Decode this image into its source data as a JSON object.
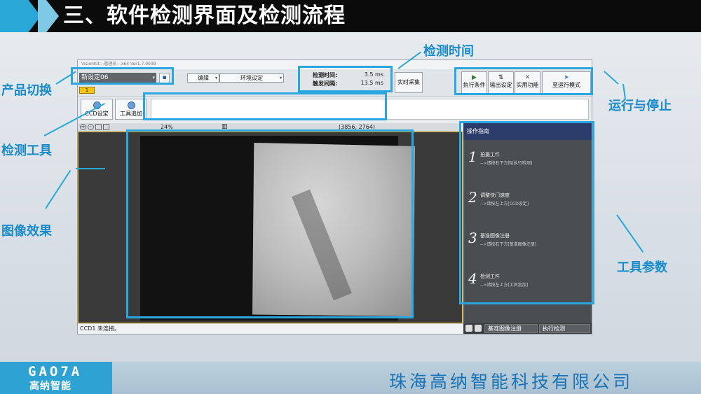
{
  "slide": {
    "title": "三、软件检测界面及检测流程",
    "company": "珠海高纳智能科技有限公司",
    "logo_text": "GAO7A",
    "logo_cn": "高纳智能"
  },
  "annotations": {
    "product_switch": "产品切换",
    "detect_time": "检测时间",
    "run_stop": "运行与停止",
    "detect_tool": "检测工具",
    "image_effect": "图像效果",
    "tool_params": "工具参数"
  },
  "app": {
    "title": "VisionKit---管理员---x64 Ver1.7.0009",
    "product_select": "新设定06",
    "badge": "1",
    "menu_edit": "编辑",
    "menu_env": "环境设定",
    "time_detect_label": "检测时间:",
    "time_detect_value": "3.5 ms",
    "time_trigger_label": "触发间隔:",
    "time_trigger_value": "13.5 ms",
    "realtime_btn": "实时采集",
    "exec_cond": "执行条件",
    "output_set": "输出设定",
    "util_func": "实用功能",
    "to_run_mode": "至运行模式",
    "ccd_set": "CCD设定",
    "tool_add": "工具追加",
    "zoom": "24%",
    "coords": "(3856, 2764)",
    "status": "CCD1 未连接。",
    "guide_title": "操作指南",
    "guide_steps": [
      {
        "num": "1",
        "title": "拍摄工件",
        "sub": "-->请按右下方的[执行检测]"
      },
      {
        "num": "2",
        "title": "调整快门速度",
        "sub": "-->请按左上方[CCD设定]"
      },
      {
        "num": "3",
        "title": "基准图像注册",
        "sub": "-->请按右下方[基准图像注册]"
      },
      {
        "num": "4",
        "title": "检测工件",
        "sub": "-->请按左上方[工具追加]"
      }
    ],
    "ref_reg": "基准图像注册",
    "exec_detect": "执行检测"
  },
  "colors": {
    "accent": "#29a8d8",
    "annotation_text": "#1a8ccc",
    "company_text": "#1a73b6"
  }
}
